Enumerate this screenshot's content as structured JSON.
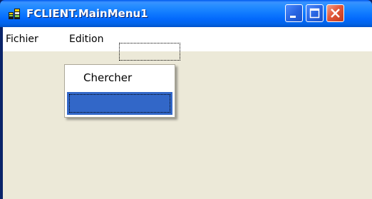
{
  "window": {
    "title": "FCLIENT.MainMenu1",
    "colors": {
      "titlebar": "#0a62f0",
      "client_background": "#ece9d8",
      "menubar_background": "#ffffff",
      "highlight": "#3267c8",
      "close_button": "#e2573a"
    }
  },
  "titlebar_buttons": {
    "minimize": "minimize-icon",
    "maximize": "maximize-icon",
    "close": "close-icon"
  },
  "menubar": {
    "items": [
      {
        "label": "Fichier"
      },
      {
        "label": "Edition"
      },
      {
        "label": ""
      }
    ]
  },
  "dropdown": {
    "items": [
      {
        "label": "Chercher",
        "selected": false
      },
      {
        "label": "",
        "selected": true
      }
    ]
  }
}
